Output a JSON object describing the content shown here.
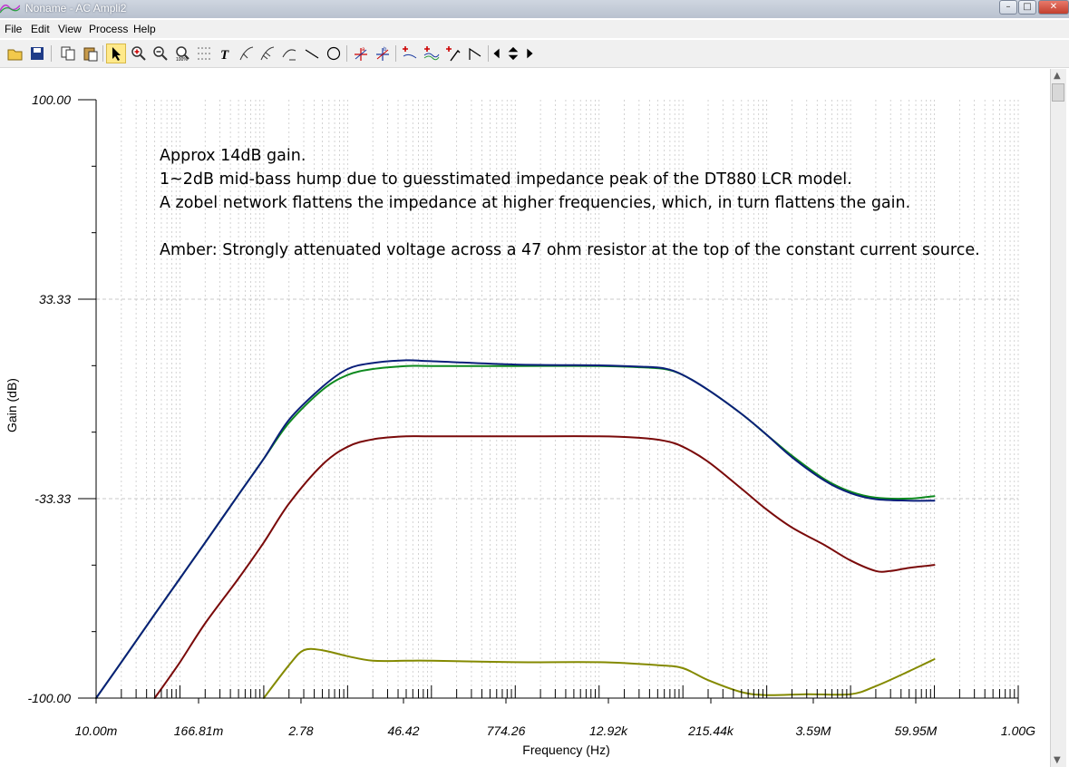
{
  "window": {
    "title": "Noname - AC Ampli2"
  },
  "menu": [
    "File",
    "Edit",
    "View",
    "Process",
    "Help"
  ],
  "toolbar": [
    "open-icon",
    "save-icon",
    "copy-icon",
    "paste-icon",
    "pointer-icon",
    "zoom-in-icon",
    "zoom-out-icon",
    "zoom-100-icon",
    "grid-icon",
    "text-icon",
    "curve-label-icon",
    "curve-label-2-icon",
    "curve-label-3-icon",
    "line-icon",
    "circle-icon",
    "cursor-a-icon",
    "cursor-b-icon",
    "add-marker-icon",
    "add-curve-icon",
    "probe-icon",
    "slope-icon",
    "left-arrow-icon",
    "updown-arrow-icon",
    "right-arrow-icon"
  ],
  "colors": {
    "blue": "#0a1f7a",
    "green": "#0e8a1f",
    "red": "#7a0a0a",
    "amber": "#848a00"
  },
  "chart_data": {
    "type": "line",
    "xscale": "log",
    "xlabel": "Frequency (Hz)",
    "ylabel": "Gain (dB)",
    "xlim": [
      0.01,
      1000000000
    ],
    "ylim": [
      -100,
      100
    ],
    "xticks": [
      {
        "value": 0.01,
        "label": "10.00m"
      },
      {
        "value": 0.16681,
        "label": "166.81m"
      },
      {
        "value": 2.78,
        "label": "2.78"
      },
      {
        "value": 46.42,
        "label": "46.42"
      },
      {
        "value": 774.26,
        "label": "774.26"
      },
      {
        "value": 12920,
        "label": "12.92k"
      },
      {
        "value": 215440,
        "label": "215.44k"
      },
      {
        "value": 3590000,
        "label": "3.59M"
      },
      {
        "value": 59950000,
        "label": "59.95M"
      },
      {
        "value": 1000000000,
        "label": "1.00G"
      }
    ],
    "yticks": [
      {
        "value": 100,
        "label": "100.00"
      },
      {
        "value": 33.33,
        "label": "33.33"
      },
      {
        "value": -33.33,
        "label": "-33.33"
      },
      {
        "value": -100,
        "label": "-100.00"
      }
    ],
    "grid": true,
    "annotations": [
      "Approx 14dB gain.",
      "1~2dB mid-bass hump due to guesstimated impedance peak of the DT880 LCR model.",
      "A zobel network flattens the impedance at higher frequencies, which, in turn flattens the gain.",
      "",
      "Amber: Strongly attenuated voltage across a 47 ohm resistor at the top of the constant current source."
    ],
    "series": [
      {
        "color": "#0e8a1f",
        "x": [
          0.01,
          0.02,
          0.05,
          0.1,
          0.2,
          0.5,
          1,
          2,
          5,
          10,
          20,
          50,
          100,
          1000,
          10000,
          30000,
          60000,
          100000,
          200000,
          500000,
          1000000,
          2000000,
          5000000,
          10000000,
          20000000,
          50000000,
          100000000
        ],
        "y": [
          -100,
          -88,
          -72,
          -60,
          -48,
          -32,
          -20,
          -8,
          3,
          8,
          10,
          11,
          11,
          11,
          11,
          10.6,
          10,
          8,
          3,
          -5,
          -12,
          -19,
          -27,
          -31,
          -33,
          -33.3,
          -32.5
        ]
      },
      {
        "color": "#0a1f7a",
        "x": [
          0.01,
          0.02,
          0.05,
          0.1,
          0.2,
          0.5,
          1,
          2,
          5,
          10,
          20,
          50,
          100,
          1000,
          10000,
          30000,
          60000,
          100000,
          200000,
          500000,
          1000000,
          2000000,
          5000000,
          10000000,
          20000000,
          50000000,
          100000000
        ],
        "y": [
          -100,
          -88,
          -72,
          -60,
          -48,
          -32,
          -20,
          -7,
          4,
          10,
          12,
          12.9,
          12.6,
          11.5,
          11.2,
          10.8,
          10.2,
          8,
          3,
          -5,
          -12,
          -19.5,
          -27.5,
          -31.5,
          -33.5,
          -34,
          -34
        ]
      },
      {
        "color": "#7a0a0a",
        "x": [
          0.05,
          0.1,
          0.2,
          0.5,
          1,
          2,
          5,
          10,
          20,
          50,
          100,
          1000,
          10000,
          30000,
          60000,
          100000,
          200000,
          500000,
          1000000,
          2000000,
          5000000,
          10000000,
          20000000,
          30000000,
          50000000,
          100000000
        ],
        "y": [
          -100,
          -88,
          -75,
          -60,
          -48,
          -35,
          -22,
          -16,
          -13.5,
          -12.5,
          -12.5,
          -12.5,
          -12.5,
          -13,
          -14,
          -16,
          -21,
          -30,
          -37,
          -43,
          -49,
          -54,
          -57.5,
          -57.5,
          -56.5,
          -55.5
        ]
      },
      {
        "color": "#848a00",
        "x": [
          1,
          2,
          3,
          5,
          10,
          20,
          50,
          100,
          1000,
          10000,
          50000,
          100000,
          200000,
          500000,
          1000000,
          3000000,
          10000000,
          20000000,
          50000000,
          100000000
        ],
        "y": [
          -100,
          -89,
          -84,
          -84,
          -86,
          -87.5,
          -87.5,
          -87.5,
          -88,
          -88,
          -89,
          -90,
          -94,
          -98,
          -99,
          -98.7,
          -98.7,
          -96,
          -91,
          -87
        ]
      }
    ]
  }
}
